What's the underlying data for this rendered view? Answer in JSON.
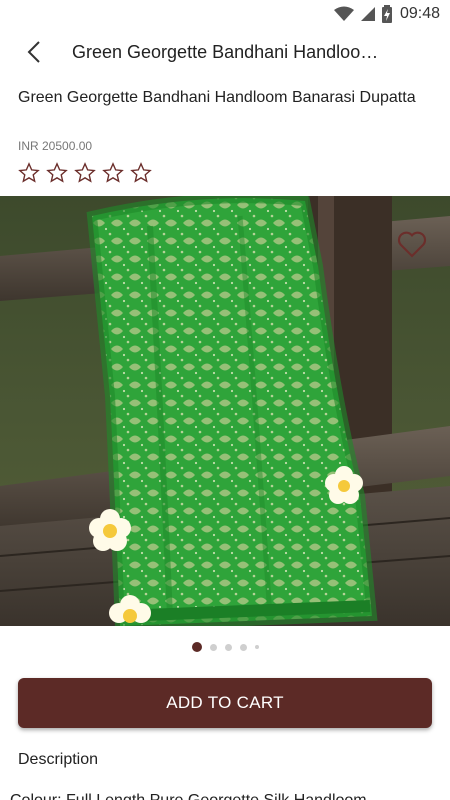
{
  "status": {
    "time": "09:48",
    "icons": [
      "wifi-icon",
      "signal-icon",
      "battery-charging-icon"
    ]
  },
  "header": {
    "back_icon": "back-arrow-icon",
    "title": "Green Georgette Bandhani Handloom Banarasi Dupatta"
  },
  "product": {
    "name": "Green Georgette Bandhani Handloom Banarasi Dupatta",
    "price": "INR 20500.00",
    "rating": 0,
    "rating_max": 5,
    "wishlist_icon": "heart-outline-icon"
  },
  "gallery": {
    "image_count": 5,
    "active_index": 0
  },
  "actions": {
    "add_to_cart": "ADD TO CART"
  },
  "description": {
    "heading": "Description",
    "text_partial": "Colour: Full Length Pure Georgette Silk Handloom"
  },
  "colors": {
    "accent": "#5c2a26",
    "star_outline": "#6b2e2b",
    "dot_active": "#5c2a26",
    "dot_inactive": "#cfcfcf"
  }
}
